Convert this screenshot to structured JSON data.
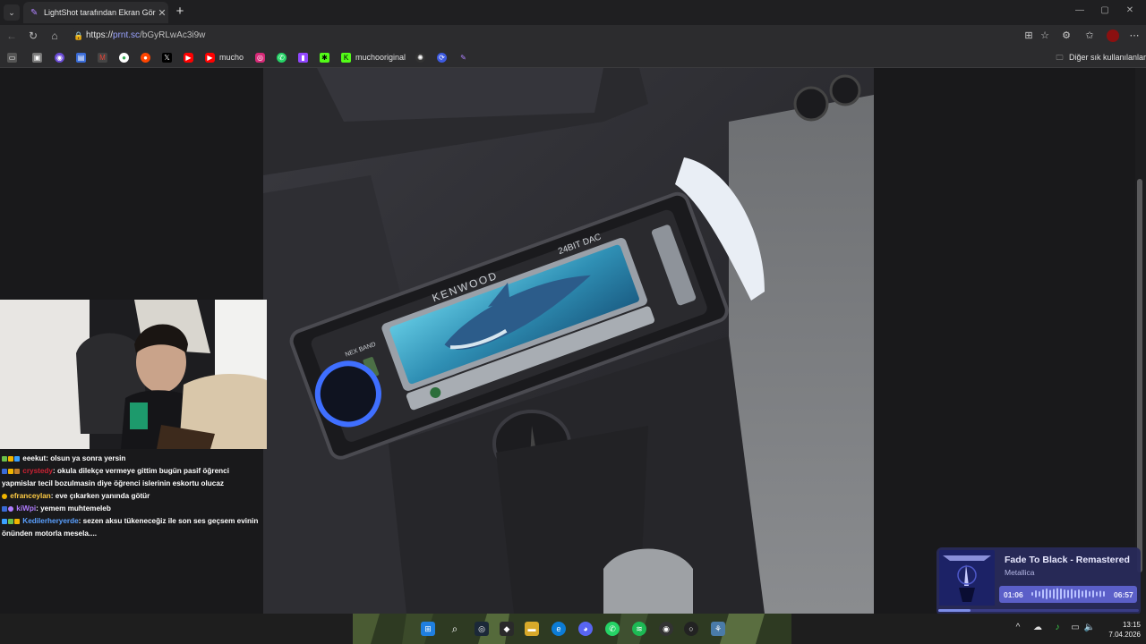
{
  "browser": {
    "tab_title": "LightShot tarafından Ekran Görünt",
    "url_scheme": "https://",
    "url_host": "prnt.sc",
    "url_path": "/bGyRLwAc3i9w",
    "bookmarks": [
      {
        "label": "",
        "icon": "reading-list-icon"
      },
      {
        "label": "",
        "icon": "bookmark-app-icon"
      },
      {
        "label": "",
        "icon": "bookmark-app-icon"
      },
      {
        "label": "",
        "icon": "bookmark-app-icon"
      },
      {
        "label": "",
        "icon": "gmail-icon"
      },
      {
        "label": "",
        "icon": "chrome-icon"
      },
      {
        "label": "",
        "icon": "reddit-icon"
      },
      {
        "label": "",
        "icon": "x-icon"
      },
      {
        "label": "",
        "icon": "youtube-icon"
      },
      {
        "label": "mucho",
        "icon": "youtube-icon"
      },
      {
        "label": "",
        "icon": "instagram-icon"
      },
      {
        "label": "",
        "icon": "whatsapp-icon"
      },
      {
        "label": "",
        "icon": "twitch-icon"
      },
      {
        "label": "",
        "icon": "kick-icon"
      },
      {
        "label": "muchooriginal",
        "icon": "kick-icon"
      },
      {
        "label": "",
        "icon": "openai-icon"
      },
      {
        "label": "",
        "icon": "bookmark-app-icon"
      },
      {
        "label": "",
        "icon": "lightshot-icon"
      }
    ],
    "other_bookmarks": "Diğer sık kullanılanlar"
  },
  "screenshot_image": {
    "brand": "KENWOOD",
    "badge": "24BIT DAC",
    "button_label": "NEX BAND"
  },
  "chat": [
    {
      "user": "eeekut",
      "text": ": olsun ya sonra yersin",
      "user_color": "#ffffff"
    },
    {
      "user": "crystedy",
      "text": ": okula dilekçe vermeye gittim bugün pasif öğrenci yapmislar tecil bozulmasin diye öğrenci islerinin eskortu olucaz",
      "user_color": "#cc2233"
    },
    {
      "user": "efranceylan",
      "text": ": eve çıkarken yanında götür",
      "user_color": "#ffcc44"
    },
    {
      "user": "kiWpi",
      "text": ": yemem muhtemeleb",
      "user_color": "#b07cff"
    },
    {
      "user": "Kedilerheryerde",
      "text": ": sezen aksu tükeneceğiz ile son ses geçsem evinin önünden motorla mesela....",
      "user_color": "#5aa0ff"
    }
  ],
  "now_playing": {
    "title": "Fade To Black - Remastered",
    "artist": "Metallica",
    "elapsed": "01:06",
    "duration": "06:57",
    "progress_fraction": 0.16
  },
  "taskbar": {
    "time": "13:15",
    "date": "7.04.2026"
  }
}
